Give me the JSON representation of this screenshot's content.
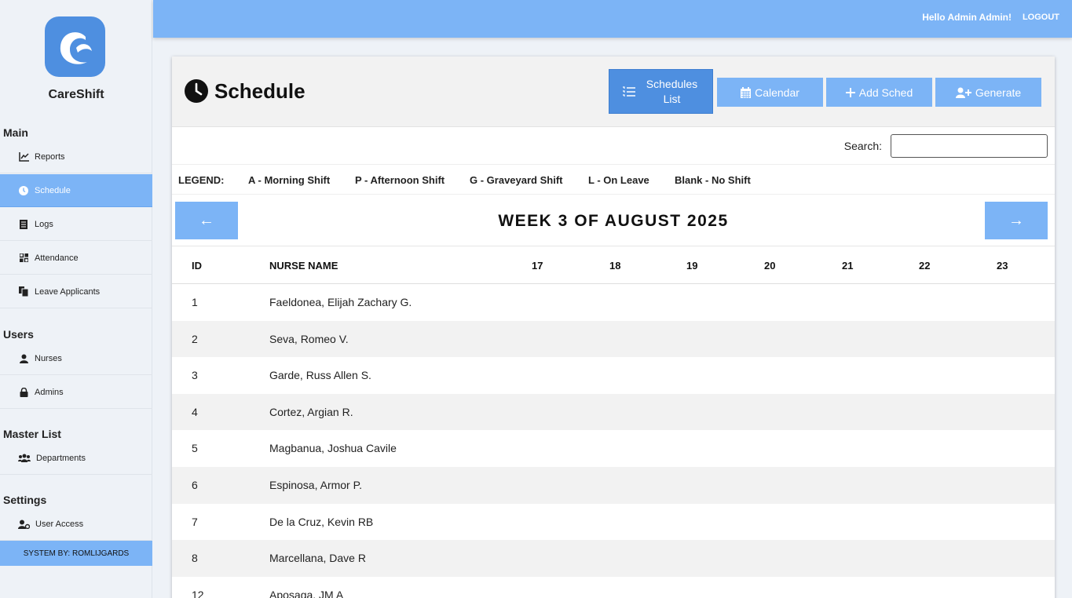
{
  "brand": {
    "name": "CareShift",
    "accent": "#4e8fe0",
    "bar_color": "#7cb4f6"
  },
  "sidebar": {
    "sections": [
      {
        "title": "Main",
        "items": [
          {
            "label": "Reports",
            "icon": "chart-line-icon"
          },
          {
            "label": "Schedule",
            "icon": "clock-icon",
            "active": true
          },
          {
            "label": "Logs",
            "icon": "document-icon"
          },
          {
            "label": "Attendance",
            "icon": "grid-icon"
          },
          {
            "label": "Leave Applicants",
            "icon": "files-icon"
          }
        ]
      },
      {
        "title": "Users",
        "items": [
          {
            "label": "Nurses",
            "icon": "nurse-icon"
          },
          {
            "label": "Admins",
            "icon": "lock-icon"
          }
        ]
      },
      {
        "title": "Master List",
        "items": [
          {
            "label": "Departments",
            "icon": "users-icon"
          }
        ]
      },
      {
        "title": "Settings",
        "items": [
          {
            "label": "User Access",
            "icon": "user-gear-icon"
          }
        ]
      }
    ],
    "footer": "SYSTEM BY: ROMLIJGARDS"
  },
  "topbar": {
    "greeting": "Hello Admin Admin!",
    "logout": "LOGOUT"
  },
  "page": {
    "title": "Schedule",
    "buttons": {
      "schedules_list": "Schedules List",
      "calendar": "Calendar",
      "add_sched": "Add Sched",
      "generate": "Generate"
    },
    "search_label": "Search:",
    "legend": {
      "label": "LEGEND:",
      "a": "A - Morning Shift",
      "p": "P - Afternoon Shift",
      "g": "G - Graveyard Shift",
      "l": "L - On Leave",
      "blank": "Blank - No Shift"
    },
    "week_title": "WEEK 3 OF AUGUST 2025",
    "prev_arrow": "←",
    "next_arrow": "→"
  },
  "table": {
    "headers": {
      "id": "ID",
      "name": "NURSE NAME",
      "days": [
        "17",
        "18",
        "19",
        "20",
        "21",
        "22",
        "23"
      ]
    },
    "rows": [
      {
        "id": "1",
        "name": "Faeldonea, Elijah Zachary G."
      },
      {
        "id": "2",
        "name": "Seva, Romeo V."
      },
      {
        "id": "3",
        "name": "Garde, Russ Allen S."
      },
      {
        "id": "4",
        "name": "Cortez, Argian R."
      },
      {
        "id": "5",
        "name": "Magbanua, Joshua Cavile"
      },
      {
        "id": "6",
        "name": "Espinosa, Armor P."
      },
      {
        "id": "7",
        "name": "De la Cruz, Kevin RB"
      },
      {
        "id": "8",
        "name": "Marcellana, Dave R"
      },
      {
        "id": "12",
        "name": "Aposaga, JM A"
      }
    ]
  }
}
